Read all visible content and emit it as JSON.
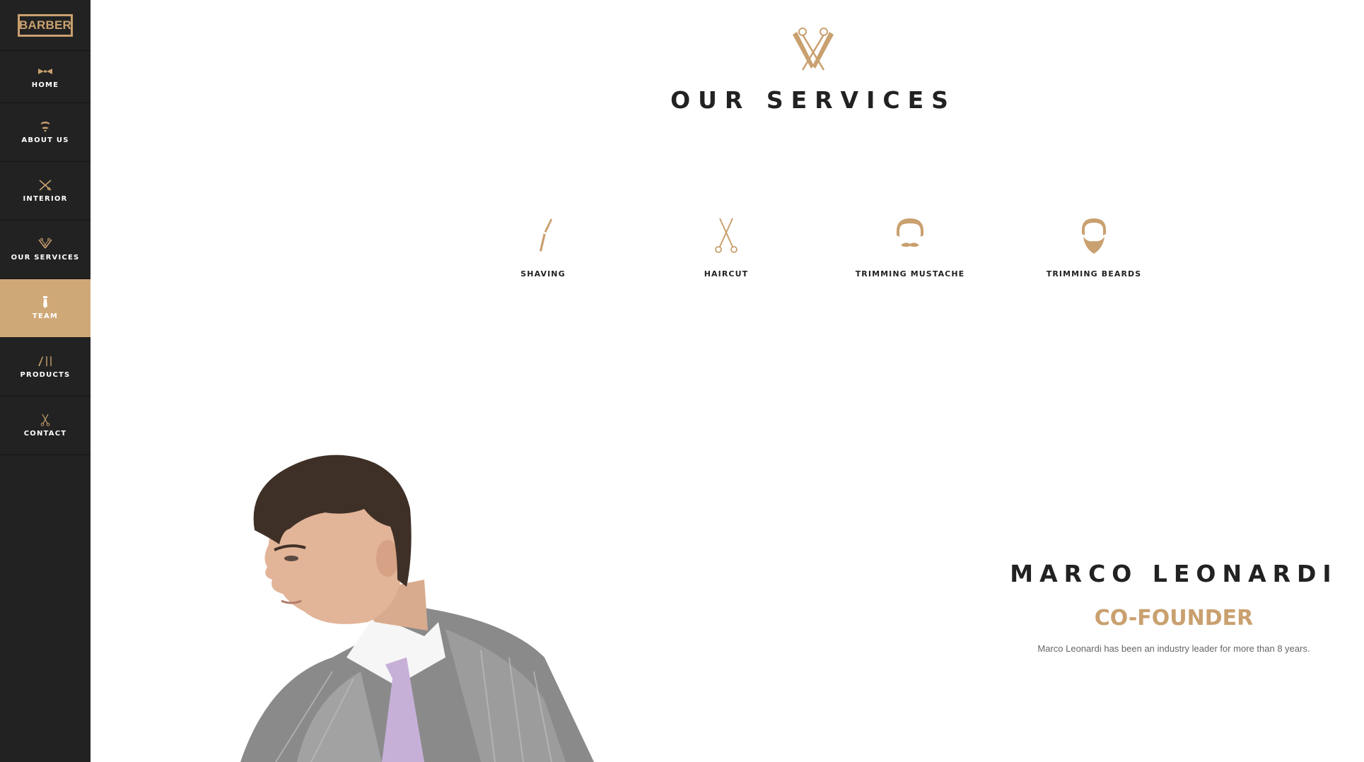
{
  "brand": {
    "logo_text": "BARBER"
  },
  "sidebar": {
    "items": [
      {
        "label": "HOME",
        "icon": "bowtie-icon",
        "active": false
      },
      {
        "label": "ABOUT US",
        "icon": "mustache-icon",
        "active": false
      },
      {
        "label": "INTERIOR",
        "icon": "crossed-tools-icon",
        "active": false
      },
      {
        "label": "OUR SERVICES",
        "icon": "scissors-razor-emblem-icon",
        "active": false
      },
      {
        "label": "TEAM",
        "icon": "tie-icon",
        "active": true
      },
      {
        "label": "PRODUCTS",
        "icon": "razor-comb-icon",
        "active": false
      },
      {
        "label": "CONTACT",
        "icon": "scissors-icon",
        "active": false
      }
    ]
  },
  "services": {
    "title": "OUR SERVICES",
    "emblem_icon": "scissors-razor-emblem-icon",
    "items": [
      {
        "label": "SHAVING",
        "icon": "razor-icon"
      },
      {
        "label": "HAIRCUT",
        "icon": "scissors-icon"
      },
      {
        "label": "TRIMMING MUSTACHE",
        "icon": "mustache-face-icon"
      },
      {
        "label": "TRIMMING BEARDS",
        "icon": "beard-face-icon"
      }
    ]
  },
  "team": {
    "member": {
      "name": "MARCO LEONARDI",
      "role": "CO-FOUNDER",
      "bio": "Marco Leonardi has been an industry leader for more than 8 years."
    }
  },
  "colors": {
    "accent": "#c9a06f",
    "active_bg": "#cfa877",
    "sidebar_bg": "#222222",
    "heading": "#222222"
  }
}
